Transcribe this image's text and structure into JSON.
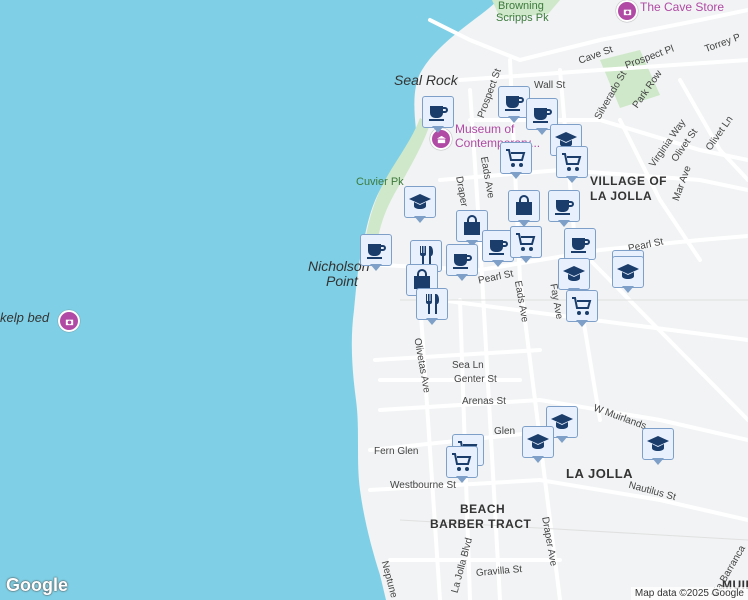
{
  "map": {
    "labels": {
      "browning": "Browning",
      "scripps_pk": "Scripps Pk",
      "cave_store": "The Cave Store",
      "seal_rock": "Seal Rock",
      "museum_1": "Museum of",
      "museum_2": "Contemporary...",
      "cuvier_pk": "Cuvier Pk",
      "nicholson_1": "Nicholson",
      "nicholson_2": "Point",
      "kelp_bed": "kelp bed",
      "village_1": "VILLAGE OF",
      "village_2": "LA JOLLA",
      "la_jolla": "LA JOLLA",
      "beach_1": "BEACH",
      "beach_2": "BARBER TRACT",
      "muir": "MUIR",
      "streets": {
        "cave_st": "Cave St",
        "prospect_pl": "Prospect Pl",
        "torrey_pines": "Torrey P",
        "wall_st": "Wall St",
        "silverado_st": "Silverado St",
        "park_row": "Park Row",
        "prospect_st": "Prospect St",
        "eads_ave_n": "Eads Ave",
        "draper_n": "Draper",
        "virginia_way": "Virginia Way",
        "olivet_st": "Olivet St",
        "olivet_ln": "Olivet Ln",
        "mar_ave": "Mar Ave",
        "pearl_st": "Pearl St",
        "pearl_st_e": "Pearl St",
        "eads_ave_s": "Eads Ave",
        "fay_ave": "Fay Ave",
        "olivetas_ave": "Olivetas Ave",
        "sea_ln": "Sea Ln",
        "genter_st": "Genter St",
        "arenas_st": "Arenas St",
        "w_muirlands": "W Muirlands",
        "glen": "Glen",
        "fern_glen": "Fern Glen",
        "westbourne": "Westbourne St",
        "nautilus_st": "Nautilus St",
        "la_jolla_blvd": "La Jolla Blvd",
        "draper_ave": "Draper Ave",
        "gravilla_st": "Gravilla St",
        "neptune": "Neptune",
        "via_barranca": "Via Barranca"
      }
    },
    "google_logo": "Google",
    "attribution": "Map data ©2025 Google",
    "markers": [
      {
        "type": "cafe"
      },
      {
        "type": "cafe"
      },
      {
        "type": "cafe"
      },
      {
        "type": "school"
      },
      {
        "type": "grocery"
      },
      {
        "type": "grocery"
      },
      {
        "type": "school"
      },
      {
        "type": "shopping"
      },
      {
        "type": "shopping"
      },
      {
        "type": "cafe"
      },
      {
        "type": "cafe"
      },
      {
        "type": "cafe"
      },
      {
        "type": "cafe"
      },
      {
        "type": "restaurant"
      },
      {
        "type": "grocery"
      },
      {
        "type": "cafe"
      },
      {
        "type": "cafe"
      },
      {
        "type": "school"
      },
      {
        "type": "school"
      },
      {
        "type": "shopping"
      },
      {
        "type": "restaurant"
      },
      {
        "type": "grocery"
      },
      {
        "type": "school"
      },
      {
        "type": "school"
      },
      {
        "type": "grocery"
      },
      {
        "type": "grocery"
      },
      {
        "type": "school"
      },
      {
        "type": "school"
      }
    ],
    "colors": {
      "water": "#7fd0e6",
      "land": "#f1f3f4",
      "park": "#cfe8c9",
      "marker_bg": "#e8f0fe",
      "marker_icon": "#1a3d6b"
    }
  }
}
